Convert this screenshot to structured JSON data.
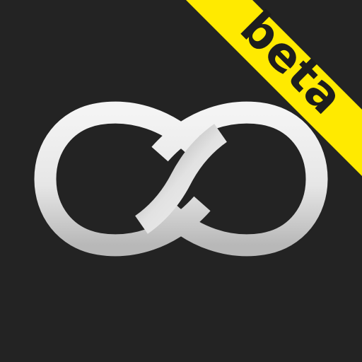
{
  "app_icon": {
    "logo": "infinity-icon",
    "badge": {
      "label": "beta"
    },
    "colors": {
      "background": "#232323",
      "ribbon": "#ffea00",
      "logo_light": "#f5f5f5",
      "logo_shade": "#c9c9c9"
    }
  }
}
